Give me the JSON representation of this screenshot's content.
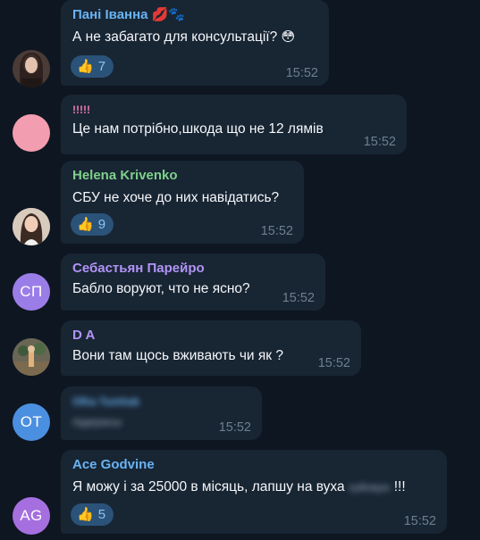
{
  "messages": [
    {
      "sender": "Пані Іванна",
      "sender_badges": "💋🐾",
      "sender_color": "#6ab3f3",
      "text": "А не забагато для консультації?",
      "text_emoji": "😳",
      "reaction": {
        "emoji": "👍",
        "count": "7"
      },
      "time": "15:52",
      "avatar": {
        "kind": "photo",
        "color": "#3a2e2c"
      }
    },
    {
      "sender": "!!!!!",
      "sender_color": "#ee7aae",
      "text": "Це нам потрібно,шкода що не 12 лямів",
      "time": "15:52",
      "avatar": {
        "kind": "color",
        "color": "#f39db0"
      }
    },
    {
      "sender": "Helena Krivenko",
      "sender_color": "#7fd18b",
      "text": "СБУ не хоче до них навідатись?",
      "reaction": {
        "emoji": "👍",
        "count": "9"
      },
      "time": "15:52",
      "avatar": {
        "kind": "photo",
        "color": "#c9b9ab"
      }
    },
    {
      "sender": "Себастьян Парейро",
      "sender_color": "#b194f7",
      "text": "Бабло воруют, что не ясно?",
      "time": "15:52",
      "avatar": {
        "kind": "initials",
        "initials": "СП",
        "color": "#9b7de8"
      }
    },
    {
      "sender": "D A",
      "sender_color": "#b194f7",
      "text": "Вони там щось вживають чи як ?",
      "time": "15:52",
      "avatar": {
        "kind": "photo",
        "color": "#5c5a4e"
      }
    },
    {
      "sender": "Olha Tumhak",
      "sender_color": "#6ab3f3",
      "text": "підерасы",
      "time": "15:52",
      "blurred": true,
      "avatar": {
        "kind": "initials",
        "initials": "OT",
        "color": "#4b8fe0"
      }
    },
    {
      "sender": "Ace Godvine",
      "sender_color": "#6ab3f3",
      "text": "Я можу і за 25000 в місяць, лапшу на вуха",
      "text_blur": "хуйовую",
      "text_tail": "!!!",
      "reaction": {
        "emoji": "👍",
        "count": "5"
      },
      "time": "15:52",
      "avatar": {
        "kind": "initials",
        "initials": "AG",
        "color": "#a66fe0"
      }
    }
  ]
}
